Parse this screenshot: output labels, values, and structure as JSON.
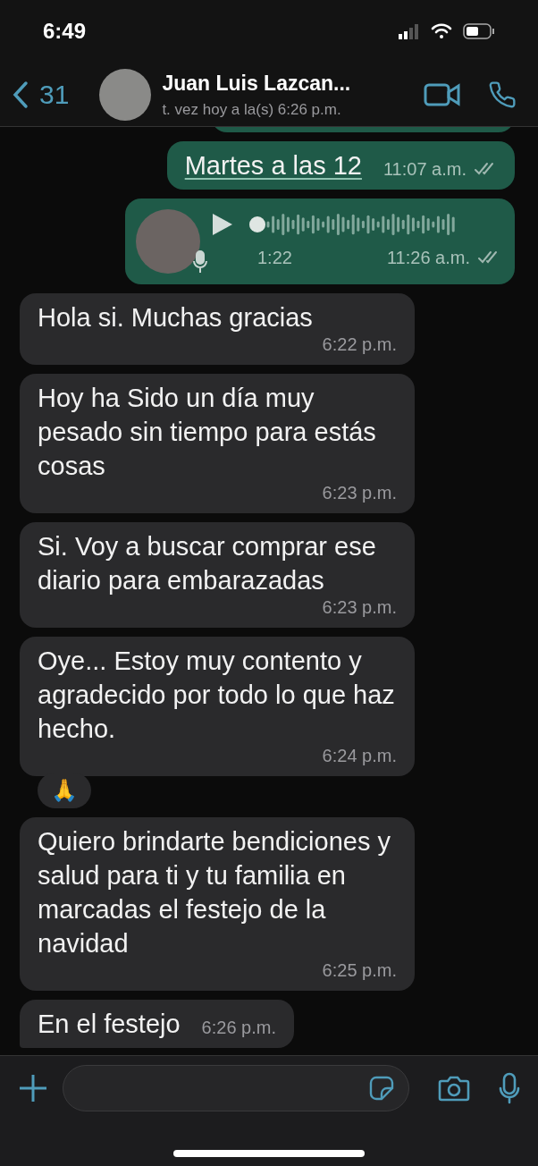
{
  "status_bar": {
    "time": "6:49"
  },
  "header": {
    "back_count": "31",
    "name": "Juan Luis Lazcan...",
    "subtitle": "t. vez hoy a la(s) 6:26 p.m."
  },
  "messages": [
    {
      "kind": "text",
      "outgoing": true,
      "text": "Martes a las 12",
      "link": true,
      "tail": false,
      "time": "11:07 a.m."
    },
    {
      "kind": "voice",
      "outgoing": true,
      "duration": "1:22",
      "time": "11:26 a.m."
    },
    {
      "kind": "text",
      "outgoing": false,
      "text": "Hola si. Muchas gracias",
      "link": false,
      "tail": false,
      "time": "6:22 p.m."
    },
    {
      "kind": "text",
      "outgoing": false,
      "text": "Hoy ha Sido un día muy pesado sin tiempo para estás cosas",
      "link": false,
      "tail": false,
      "time": "6:23 p.m."
    },
    {
      "kind": "text",
      "outgoing": false,
      "text": "Si.  Voy a buscar comprar ese diario para embarazadas",
      "link": false,
      "tail": false,
      "time": "6:23 p.m."
    },
    {
      "kind": "text",
      "outgoing": false,
      "text": "Oye...   Estoy muy contento y agradecido por todo lo que haz hecho.",
      "link": false,
      "tail": false,
      "time": "6:24 p.m.",
      "reaction": "🙏"
    },
    {
      "kind": "text",
      "outgoing": false,
      "text": "Quiero brindarte bendiciones y salud para ti y tu familia en marcadas el festejo de la navidad",
      "link": false,
      "tail": false,
      "time": "6:25 p.m."
    },
    {
      "kind": "text",
      "outgoing": false,
      "text": "En el festejo",
      "link": false,
      "tail": true,
      "time": "6:26 p.m."
    }
  ]
}
